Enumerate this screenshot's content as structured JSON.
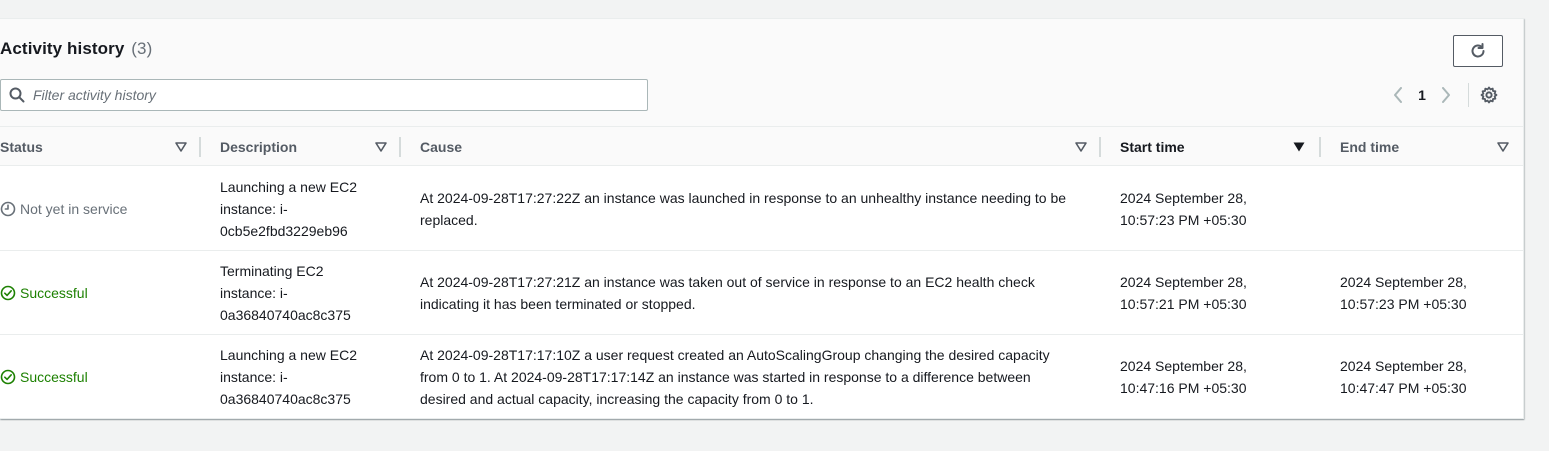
{
  "header": {
    "title": "Activity history",
    "count": "(3)",
    "filter_placeholder": "Filter activity history",
    "page": "1"
  },
  "columns": [
    {
      "label": "Status"
    },
    {
      "label": "Description"
    },
    {
      "label": "Cause"
    },
    {
      "label": "Start time"
    },
    {
      "label": "End time"
    }
  ],
  "rows": [
    {
      "status": "Not yet in service",
      "status_kind": "pending",
      "description": [
        "Launching a new EC2",
        "instance: i-",
        "0cb5e2fbd3229eb96"
      ],
      "cause": [
        "At 2024-09-28T17:27:22Z an instance was launched in response to an unhealthy instance needing to be",
        "replaced."
      ],
      "start": [
        "2024 September 28,",
        "10:57:23 PM +05:30"
      ],
      "end": [
        "",
        ""
      ]
    },
    {
      "status": "Successful",
      "status_kind": "success",
      "description": [
        "Terminating EC2",
        "instance: i-",
        "0a36840740ac8c375"
      ],
      "cause": [
        "At 2024-09-28T17:27:21Z an instance was taken out of service in response to an EC2 health check",
        "indicating it has been terminated or stopped."
      ],
      "start": [
        "2024 September 28,",
        "10:57:21 PM +05:30"
      ],
      "end": [
        "2024 September 28,",
        "10:57:23 PM +05:30"
      ]
    },
    {
      "status": "Successful",
      "status_kind": "success",
      "description": [
        "Launching a new EC2",
        "instance: i-",
        "0a36840740ac8c375"
      ],
      "cause": [
        "At 2024-09-28T17:17:10Z a user request created an AutoScalingGroup changing the desired capacity",
        "from 0 to 1. At 2024-09-28T17:17:14Z an instance was started in response to a difference between",
        "desired and actual capacity, increasing the capacity from 0 to 1."
      ],
      "start": [
        "2024 September 28,",
        "10:47:16 PM +05:30"
      ],
      "end": [
        "2024 September 28,",
        "10:47:47 PM +05:30"
      ]
    }
  ],
  "colors": {
    "success": "#1d8102",
    "pending": "#687078",
    "header_text": "#545b64"
  }
}
